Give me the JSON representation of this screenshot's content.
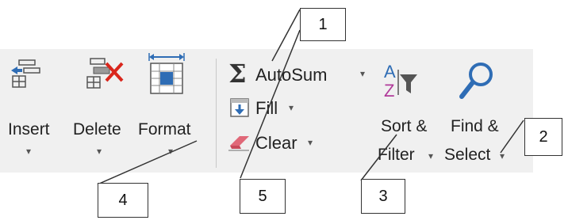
{
  "ribbon": {
    "cells": {
      "insert": {
        "label": "Insert",
        "icon": "insert-cells-icon"
      },
      "delete": {
        "label": "Delete",
        "icon": "delete-cells-icon"
      },
      "format": {
        "label": "Format",
        "icon": "format-cells-icon"
      }
    },
    "editing": {
      "autosum": {
        "label": "AutoSum",
        "icon": "sigma-icon"
      },
      "fill": {
        "label": "Fill",
        "icon": "fill-down-icon"
      },
      "clear": {
        "label": "Clear",
        "icon": "eraser-icon"
      },
      "sort_filter": {
        "label_line1": "Sort &",
        "label_line2": "Filter",
        "icon": "sort-filter-icon"
      },
      "find_select": {
        "label_line1": "Find &",
        "label_line2": "Select",
        "icon": "magnifier-icon"
      }
    }
  },
  "callouts": [
    "1",
    "2",
    "3",
    "4",
    "5"
  ],
  "colors": {
    "ribbon_bg": "#f0f0f0",
    "icon_blue": "#2f6db5",
    "icon_red": "#d9261c"
  }
}
